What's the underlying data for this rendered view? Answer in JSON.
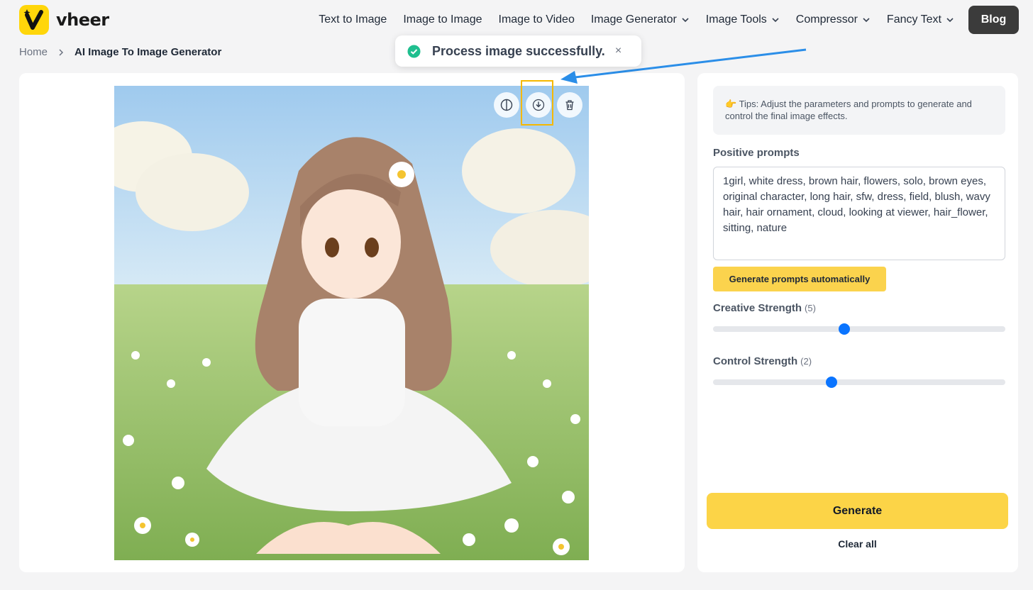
{
  "brand": {
    "name": "vheer",
    "accent": "#ffd60a"
  },
  "nav": {
    "items": [
      {
        "label": "Text to Image",
        "dropdown": false
      },
      {
        "label": "Image to Image",
        "dropdown": false
      },
      {
        "label": "Image to Video",
        "dropdown": false
      },
      {
        "label": "Image Generator",
        "dropdown": true
      },
      {
        "label": "Image Tools",
        "dropdown": true
      },
      {
        "label": "Compressor",
        "dropdown": true
      },
      {
        "label": "Fancy Text",
        "dropdown": true
      }
    ],
    "blog_label": "Blog"
  },
  "breadcrumb": {
    "home": "Home",
    "current": "AI Image To Image Generator"
  },
  "toast": {
    "message": "Process image successfully.",
    "close": "×",
    "icon": "check-circle-icon",
    "color": "#1fbf8f"
  },
  "image_tools": {
    "compare_icon": "compare-icon",
    "download_icon": "download-icon",
    "delete_icon": "trash-icon"
  },
  "annotation": {
    "color": "#2b8ee8",
    "highlight_color": "#f5b800"
  },
  "settings": {
    "tips": "Tips: Adjust the parameters and prompts to generate and control the final image effects.",
    "positive_label": "Positive prompts",
    "positive_text": "1girl, white dress, brown hair, flowers, solo, brown eyes, original character, long hair, sfw, dress, field, blush, wavy hair, hair ornament, cloud, looking at viewer, hair_flower, sitting, nature",
    "gen_prompts_label": "Generate prompts automatically",
    "creative_label": "Creative Strength",
    "creative_value": "(5)",
    "creative_fraction": 0.45,
    "control_label": "Control Strength",
    "control_value": "(2)",
    "control_fraction": 0.405,
    "slider_color": "#0a74ff"
  },
  "actions": {
    "generate": "Generate",
    "clear": "Clear all",
    "generate_color": "#fcd447"
  }
}
